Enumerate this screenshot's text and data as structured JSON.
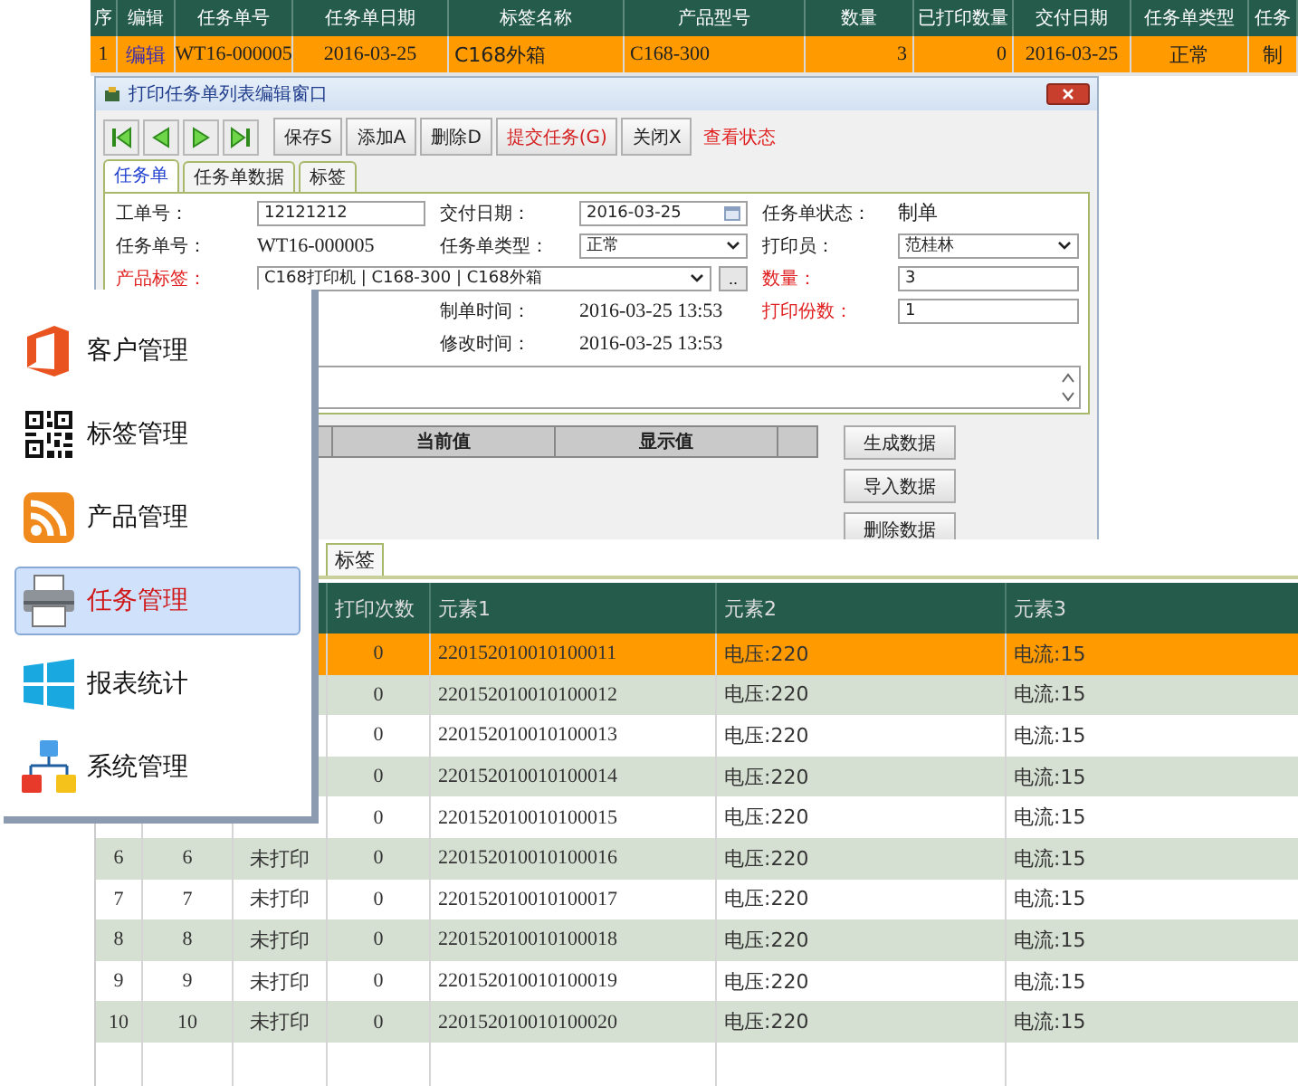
{
  "task_grid": {
    "columns": [
      "序",
      "编辑",
      "任务单号",
      "任务单日期",
      "标签名称",
      "产品型号",
      "数量",
      "已打印数量",
      "交付日期",
      "任务单类型",
      "任务"
    ],
    "rows": [
      {
        "selected": true,
        "cells": [
          "1",
          "编辑",
          "WT16-000005",
          "2016-03-25",
          "C168外箱",
          "C168-300",
          "3",
          "0",
          "2016-03-25",
          "正常",
          "制"
        ]
      }
    ]
  },
  "dialog": {
    "title": "打印任务单列表编辑窗口",
    "buttons": [
      {
        "label": "保存S",
        "kind": "normal"
      },
      {
        "label": "添加A",
        "kind": "normal"
      },
      {
        "label": "删除D",
        "kind": "normal"
      },
      {
        "label": "提交任务(G)",
        "kind": "accent"
      },
      {
        "label": "关闭X",
        "kind": "normal"
      }
    ],
    "link": "查看状态",
    "tabs": [
      {
        "label": "任务单",
        "selected": true
      },
      {
        "label": "任务单数据",
        "selected": false
      },
      {
        "label": "标签",
        "selected": false
      }
    ],
    "form": [
      [
        {
          "kind": "label",
          "text": "工单号：",
          "required": false
        },
        {
          "kind": "input",
          "value": "12121212"
        },
        {
          "kind": "label",
          "text": "交付日期：",
          "required": false
        },
        {
          "kind": "date",
          "value": "2016-03-25"
        },
        {
          "kind": "label",
          "text": "任务单状态：",
          "required": false
        },
        {
          "kind": "text",
          "text": "制单"
        }
      ],
      [
        {
          "kind": "label",
          "text": "任务单号：",
          "required": false
        },
        {
          "kind": "text",
          "text": "WT16-000005"
        },
        {
          "kind": "label",
          "text": "任务单类型：",
          "required": false
        },
        {
          "kind": "select",
          "value": "正常"
        },
        {
          "kind": "label",
          "text": "打印员：",
          "required": false
        },
        {
          "kind": "select",
          "value": "范桂林"
        }
      ],
      [
        {
          "kind": "label",
          "text": "产品标签：",
          "required": true
        },
        {
          "kind": "picker",
          "value": "C168打印机 | C168-300 | C168外箱",
          "button": ".."
        },
        {
          "kind": "label",
          "text": "数量：",
          "required": true
        },
        {
          "kind": "input",
          "value": "3"
        }
      ],
      [
        {
          "kind": "blank"
        },
        {
          "kind": "blank"
        },
        {
          "kind": "label",
          "text": "制单时间：",
          "required": false
        },
        {
          "kind": "text",
          "text": "2016-03-25 13:53"
        },
        {
          "kind": "label",
          "text": "打印份数：",
          "required": true
        },
        {
          "kind": "input",
          "value": "1"
        }
      ],
      [
        {
          "kind": "blank"
        },
        {
          "kind": "blank"
        },
        {
          "kind": "label",
          "text": "修改时间：",
          "required": false
        },
        {
          "kind": "text",
          "text": "2016-03-25 13:53"
        },
        {
          "kind": "blank"
        },
        {
          "kind": "blank"
        }
      ]
    ],
    "value_grid": {
      "columns": [
        "当前值",
        "显示值"
      ]
    },
    "side_buttons": [
      "生成数据",
      "导入数据",
      "删除数据"
    ]
  },
  "label_panel": {
    "tab": "标签",
    "columns": [
      "打印次数",
      "元素1",
      "元素2",
      "元素3"
    ],
    "rows": [
      {
        "selected": true,
        "count": "0",
        "code": "220152010010100011",
        "e2": "电压:220",
        "e3": "电流:15"
      },
      {
        "selected": false,
        "count": "0",
        "code": "220152010010100012",
        "e2": "电压:220",
        "e3": "电流:15"
      },
      {
        "selected": false,
        "count": "0",
        "code": "220152010010100013",
        "e2": "电压:220",
        "e3": "电流:15"
      },
      {
        "selected": false,
        "count": "0",
        "code": "220152010010100014",
        "e2": "电压:220",
        "e3": "电流:15"
      },
      {
        "selected": false,
        "count": "0",
        "code": "220152010010100015",
        "e2": "电压:220",
        "e3": "电流:15"
      },
      {
        "selected": false,
        "no": "6",
        "seq": "6",
        "status": "未打印",
        "count": "0",
        "code": "220152010010100016",
        "e2": "电压:220",
        "e3": "电流:15"
      },
      {
        "selected": false,
        "no": "7",
        "seq": "7",
        "status": "未打印",
        "count": "0",
        "code": "220152010010100017",
        "e2": "电压:220",
        "e3": "电流:15"
      },
      {
        "selected": false,
        "no": "8",
        "seq": "8",
        "status": "未打印",
        "count": "0",
        "code": "220152010010100018",
        "e2": "电压:220",
        "e3": "电流:15"
      },
      {
        "selected": false,
        "no": "9",
        "seq": "9",
        "status": "未打印",
        "count": "0",
        "code": "220152010010100019",
        "e2": "电压:220",
        "e3": "电流:15"
      },
      {
        "selected": false,
        "no": "10",
        "seq": "10",
        "status": "未打印",
        "count": "0",
        "code": "220152010010100020",
        "e2": "电压:220",
        "e3": "电流:15"
      }
    ]
  },
  "sidebar": {
    "items": [
      {
        "label": "客户管理",
        "selected": false
      },
      {
        "label": "标签管理",
        "selected": false
      },
      {
        "label": "产品管理",
        "selected": false
      },
      {
        "label": "任务管理",
        "selected": true
      },
      {
        "label": "报表统计",
        "selected": false
      },
      {
        "label": "系统管理",
        "selected": false
      }
    ]
  }
}
